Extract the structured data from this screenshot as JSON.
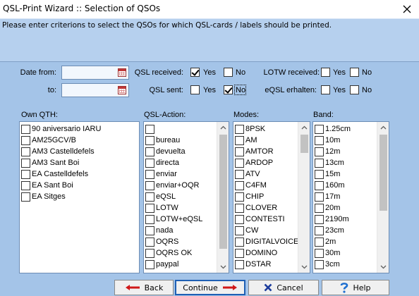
{
  "window": {
    "title": "QSL-Print Wizard :: Selection of QSOs",
    "close_icon": "close-icon"
  },
  "instruction": "Please enter criterions to select the QSOs for which QSL-cards / labels should be printed.",
  "date": {
    "from_label": "Date from:",
    "to_label": "to:",
    "from_value": "",
    "to_value": "",
    "icon": "calendar-icon"
  },
  "qsl_received": {
    "label": "QSL received:",
    "yes_label": "Yes",
    "no_label": "No",
    "yes": true,
    "no": false
  },
  "qsl_sent": {
    "label": "QSL sent:",
    "yes_label": "Yes",
    "no_label": "No",
    "yes": false,
    "no": true
  },
  "lotw_received": {
    "label": "LOTW received:",
    "yes_label": "Yes",
    "no_label": "No",
    "yes": false,
    "no": false
  },
  "eqsl_received": {
    "label": "eQSL erhalten:",
    "yes_label": "Yes",
    "no_label": "No",
    "yes": false,
    "no": false
  },
  "own_qth": {
    "header": "Own QTH:",
    "items": [
      "90 aniversario IARU",
      "AM25GCV/B",
      "AM3 Castelldefels",
      "AM3 Sant Boi",
      "EA Castelldefels",
      "EA Sant Boi",
      "EA Sitges"
    ]
  },
  "qsl_action": {
    "header": "QSL-Action:",
    "items": [
      "",
      "bureau",
      "devuelta",
      "directa",
      "enviar",
      "enviar+OQR",
      "eQSL",
      "LOTW",
      "LOTW+eQSL",
      "nada",
      "OQRS",
      "OQRS OK",
      "paypal"
    ]
  },
  "modes": {
    "header": "Modes:",
    "items": [
      "8PSK",
      "AM",
      "AMTOR",
      "ARDOP",
      "ATV",
      "C4FM",
      "CHIP",
      "CLOVER",
      "CONTESTI",
      "CW",
      "DIGITALVOICE",
      "DOMINO",
      "DSTAR"
    ]
  },
  "band": {
    "header": "Band:",
    "items": [
      "1.25cm",
      "10m",
      "12m",
      "13cm",
      "15m",
      "160m",
      "17m",
      "20m",
      "2190m",
      "23cm",
      "2m",
      "30m",
      "3cm"
    ]
  },
  "buttons": {
    "back": "Back",
    "continue": "Continue",
    "cancel": "Cancel",
    "help": "Help"
  },
  "colors": {
    "background": "#a4c4e8",
    "instruction_background": "#b6d0ee",
    "arrow_red": "#d01818",
    "cancel_x": "#1c3c9c",
    "help_icon": "#1e6fd0"
  }
}
